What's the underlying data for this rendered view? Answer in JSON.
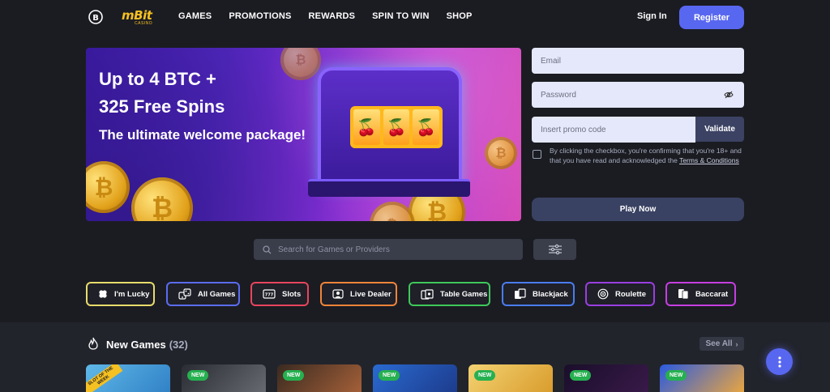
{
  "header": {
    "logo_text": "mBit",
    "logo_sub": "CASINO",
    "nav": [
      "GAMES",
      "PROMOTIONS",
      "REWARDS",
      "SPIN TO WIN",
      "SHOP"
    ],
    "signin_label": "Sign In",
    "register_label": "Register"
  },
  "banner": {
    "headline_1": "Up to 4 BTC +",
    "headline_2": "325 Free Spins",
    "subline": "The ultimate welcome package!"
  },
  "form": {
    "email_placeholder": "Email",
    "password_placeholder": "Password",
    "promo_placeholder": "Insert promo code",
    "validate_label": "Validate",
    "consent_text": "By clicking the checkbox, you're confirming that you're 18+ and that you have read and acknowledged the ",
    "consent_link": "Terms & Conditions",
    "play_label": "Play Now"
  },
  "search": {
    "placeholder": "Search for Games or Providers"
  },
  "categories": [
    {
      "label": "I'm Lucky",
      "icon": "clover-icon",
      "color": "#e8dc6a"
    },
    {
      "label": "All Games",
      "icon": "dice-icon",
      "color": "#5a6cf0"
    },
    {
      "label": "Slots",
      "icon": "slot-icon",
      "color": "#e8455c"
    },
    {
      "label": "Live Dealer",
      "icon": "dealer-icon",
      "color": "#f0843a"
    },
    {
      "label": "Table Games",
      "icon": "table-icon",
      "color": "#3ec95a"
    },
    {
      "label": "Blackjack",
      "icon": "cards-icon",
      "color": "#4a7cf0"
    },
    {
      "label": "Roulette",
      "icon": "roulette-icon",
      "color": "#9a3ee0"
    },
    {
      "label": "Baccarat",
      "icon": "baccarat-icon",
      "color": "#c53ee0"
    }
  ],
  "new_games": {
    "title": "New Games",
    "count": "(32)",
    "see_all": "See All",
    "badge": "NEW",
    "first_card_ribbon": "SLOT OF THE WEEK"
  },
  "colors": {
    "accent": "#5867f0",
    "background": "#1b1c22",
    "new_badge": "#26b050"
  }
}
